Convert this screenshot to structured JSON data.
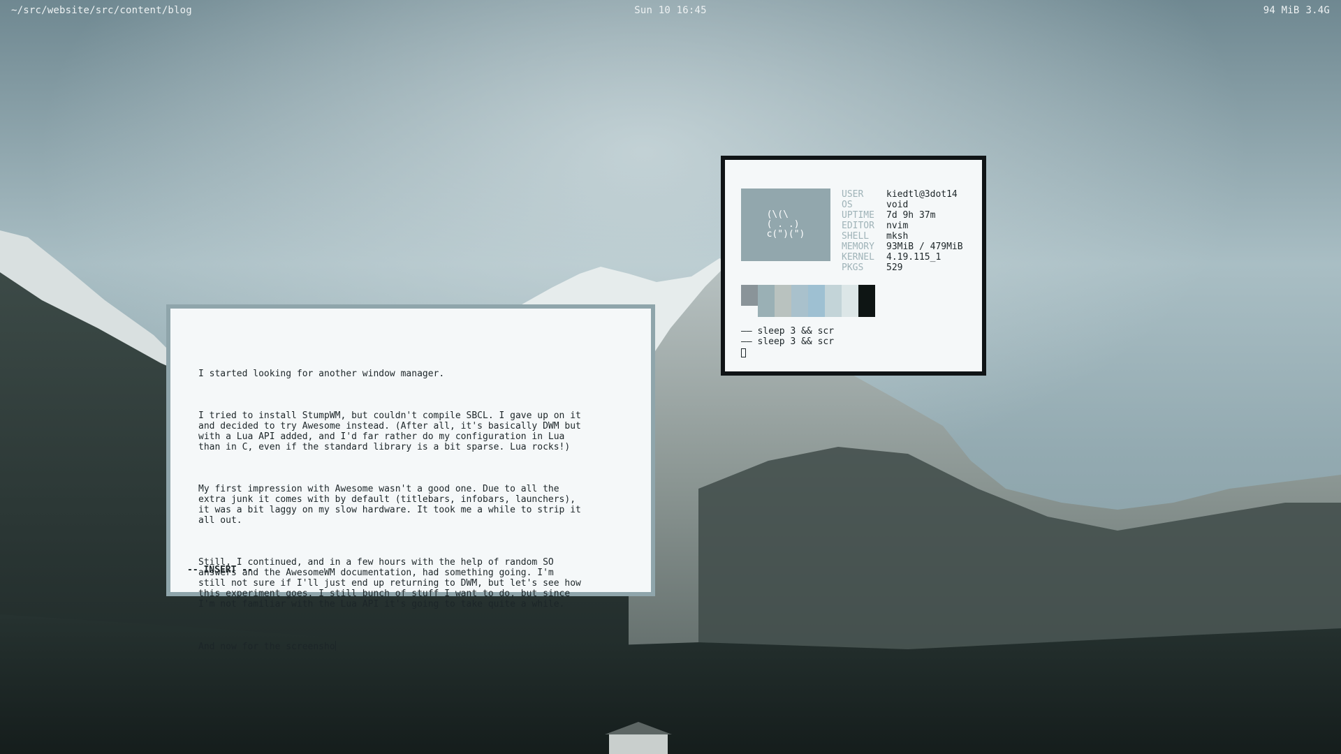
{
  "topbar": {
    "cwd": "~/src/website/src/content/blog",
    "clock": "Sun 10 16:45",
    "memory": "94 MiB",
    "disk": "3.4G"
  },
  "editor": {
    "paragraphs": [
      "I started looking for another window manager.",
      "I tried to install StumpWM, but couldn't compile SBCL. I gave up on it\nand decided to try Awesome instead. (After all, it's basically DWM but\nwith a Lua API added, and I'd far rather do my configuration in Lua\nthan in C, even if the standard library is a bit sparse. Lua rocks!)",
      "My first impression with Awesome wasn't a good one. Due to all the\nextra junk it comes with by default (titlebars, infobars, launchers),\nit was a bit laggy on my slow hardware. It took me a while to strip it\nall out.",
      "Still, I continued, and in a few hours with the help of random SO\nanswers and the AwesomeWM documentation, had something going. I'm\nstill not sure if I'll just end up returning to DWM, but let's see how\nthis experiment goes. I still bunch of stuff I want to do, but since\nI'm not familiar with the Lua API it's going to take quite a while."
    ],
    "current_line": "And now for the screensho",
    "mode": "-- INSERT --"
  },
  "fetch": {
    "logo_lines": [
      "(\\(\\",
      "( . .)",
      "c(\")(\")"
    ],
    "info": [
      {
        "key": "USER",
        "value": "kiedtl@3dot14"
      },
      {
        "key": "OS",
        "value": "void"
      },
      {
        "key": "UPTIME",
        "value": "7d 9h 37m"
      },
      {
        "key": "EDITOR",
        "value": "nvim"
      },
      {
        "key": "SHELL",
        "value": "mksh"
      },
      {
        "key": "MEMORY",
        "value": "93MiB / 479MiB"
      },
      {
        "key": "KERNEL",
        "value": "4.19.115_1"
      },
      {
        "key": "PKGS",
        "value": "529"
      }
    ],
    "palette": [
      "#8a9499",
      "#9ab0b5",
      "#b9c2bf",
      "#a9c1cc",
      "#9ec0d2",
      "#c3d4d8",
      "#dce6e7",
      "#0e1514"
    ],
    "shell_lines": [
      "—— sleep 3 && scr",
      "—— sleep 3 && scr"
    ]
  },
  "colors": {
    "window_bg": "#f5f8f9",
    "editor_border": "#8fa5ab",
    "fetch_border": "#101416",
    "logo_bg": "#92a7ad",
    "label_gray": "#9fb3b8"
  }
}
